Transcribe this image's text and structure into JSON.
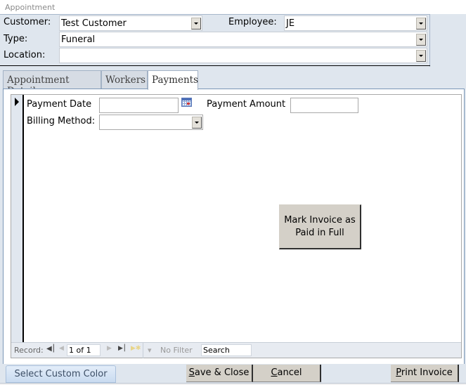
{
  "window": {
    "title": "Appointment"
  },
  "header": {
    "customer": {
      "label": "Customer:",
      "value": "Test Customer"
    },
    "employee": {
      "label": "Employee:",
      "value": "JE"
    },
    "type": {
      "label": "Type:",
      "value": "Funeral"
    },
    "location": {
      "label": "Location:",
      "value": ""
    }
  },
  "tabs": [
    {
      "label": "Appointment Details",
      "active": false
    },
    {
      "label": "Workers",
      "active": false
    },
    {
      "label": "Payments",
      "active": true
    }
  ],
  "payments": {
    "payment_date": {
      "label": "Payment Date",
      "value": ""
    },
    "payment_amount": {
      "label": "Payment Amount",
      "value": ""
    },
    "billing_method": {
      "label": "Billing Method:",
      "value": ""
    },
    "mark_paid_button": {
      "line1": "Mark Invoice as",
      "line2": "Paid in Full"
    }
  },
  "record_nav": {
    "label": "Record:",
    "position": "1 of 1",
    "filter": "No Filter",
    "search_placeholder": "Search"
  },
  "footer": {
    "custom_color": "Select Custom Color",
    "save_close": {
      "accel": "S",
      "rest": "ave & Close"
    },
    "cancel": {
      "accel": "C",
      "rest": "ancel"
    },
    "print_invoice": {
      "accel": "P",
      "rest": "rint Invoice"
    }
  }
}
